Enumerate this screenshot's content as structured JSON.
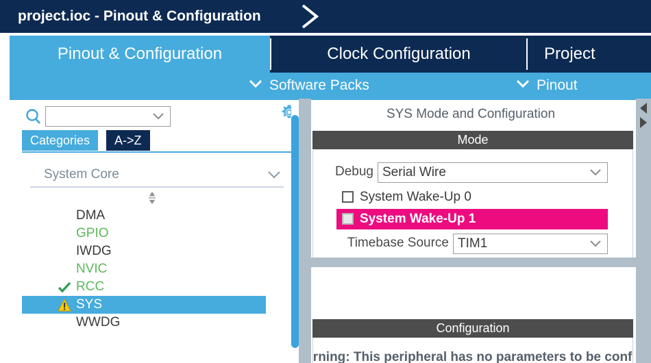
{
  "titlebar": {
    "text": "project.ioc - Pinout & Configuration",
    "chevron_icon": "chevron-right-icon"
  },
  "tabs": [
    {
      "label": "Pinout & Configuration",
      "active": true
    },
    {
      "label": "Clock Configuration",
      "active": false
    },
    {
      "label": "Project",
      "active": false
    }
  ],
  "subbar": [
    {
      "label": "Software Packs",
      "icon": "chevron-down-icon"
    },
    {
      "label": "Pinout",
      "icon": "chevron-down-icon"
    }
  ],
  "sidebar": {
    "search": {
      "icon": "search-icon",
      "value": "",
      "placeholder": "",
      "dropdown_icon": "chevron-down-icon"
    },
    "settings_icon": "gear-icon",
    "view_tabs": [
      {
        "label": "Categories",
        "selected": true
      },
      {
        "label": "A->Z",
        "selected": false
      }
    ],
    "group": {
      "title": "System Core",
      "collapse_icon": "chevron-down-icon",
      "splitter_icon": "vertical-resize-handle-icon"
    },
    "peripherals": [
      {
        "label": "DMA",
        "state": "default",
        "selected": false,
        "status_icon": ""
      },
      {
        "label": "GPIO",
        "state": "green",
        "selected": false,
        "status_icon": ""
      },
      {
        "label": "IWDG",
        "state": "default",
        "selected": false,
        "status_icon": ""
      },
      {
        "label": "NVIC",
        "state": "green",
        "selected": false,
        "status_icon": ""
      },
      {
        "label": "RCC",
        "state": "green",
        "selected": false,
        "status_icon": "check-icon"
      },
      {
        "label": "SYS",
        "state": "selected",
        "selected": true,
        "status_icon": "warning-icon"
      },
      {
        "label": "WWDG",
        "state": "default",
        "selected": false,
        "status_icon": ""
      }
    ],
    "scrollbar": "vertical-scrollbar"
  },
  "details": {
    "title": "SYS Mode and Configuration",
    "mode_section": {
      "header": "Mode",
      "debug": {
        "label": "Debug",
        "value": "Serial Wire",
        "dropdown_icon": "chevron-down-icon"
      },
      "checkboxes": [
        {
          "label": "System Wake-Up 0",
          "checked": false,
          "highlighted": false
        },
        {
          "label": "System Wake-Up 1",
          "checked": false,
          "highlighted": true
        }
      ],
      "timebase": {
        "label": "Timebase Source",
        "value": "TIM1",
        "dropdown_icon": "chevron-down-icon"
      }
    },
    "config_section": {
      "header": "Configuration",
      "warning_text": "Warning: This peripheral has no parameters to be configured."
    },
    "collapse_icons": [
      "triangle-left-icon",
      "triangle-right-icon"
    ]
  },
  "colors": {
    "navy": "#0d2a52",
    "blue": "#46abdd",
    "magenta": "#ec0c80",
    "dark_gray": "#4d4d4d",
    "splitter_gray": "#b0bec9",
    "green_text": "#5cb85c",
    "warn_yellow": "#ffcc00"
  }
}
